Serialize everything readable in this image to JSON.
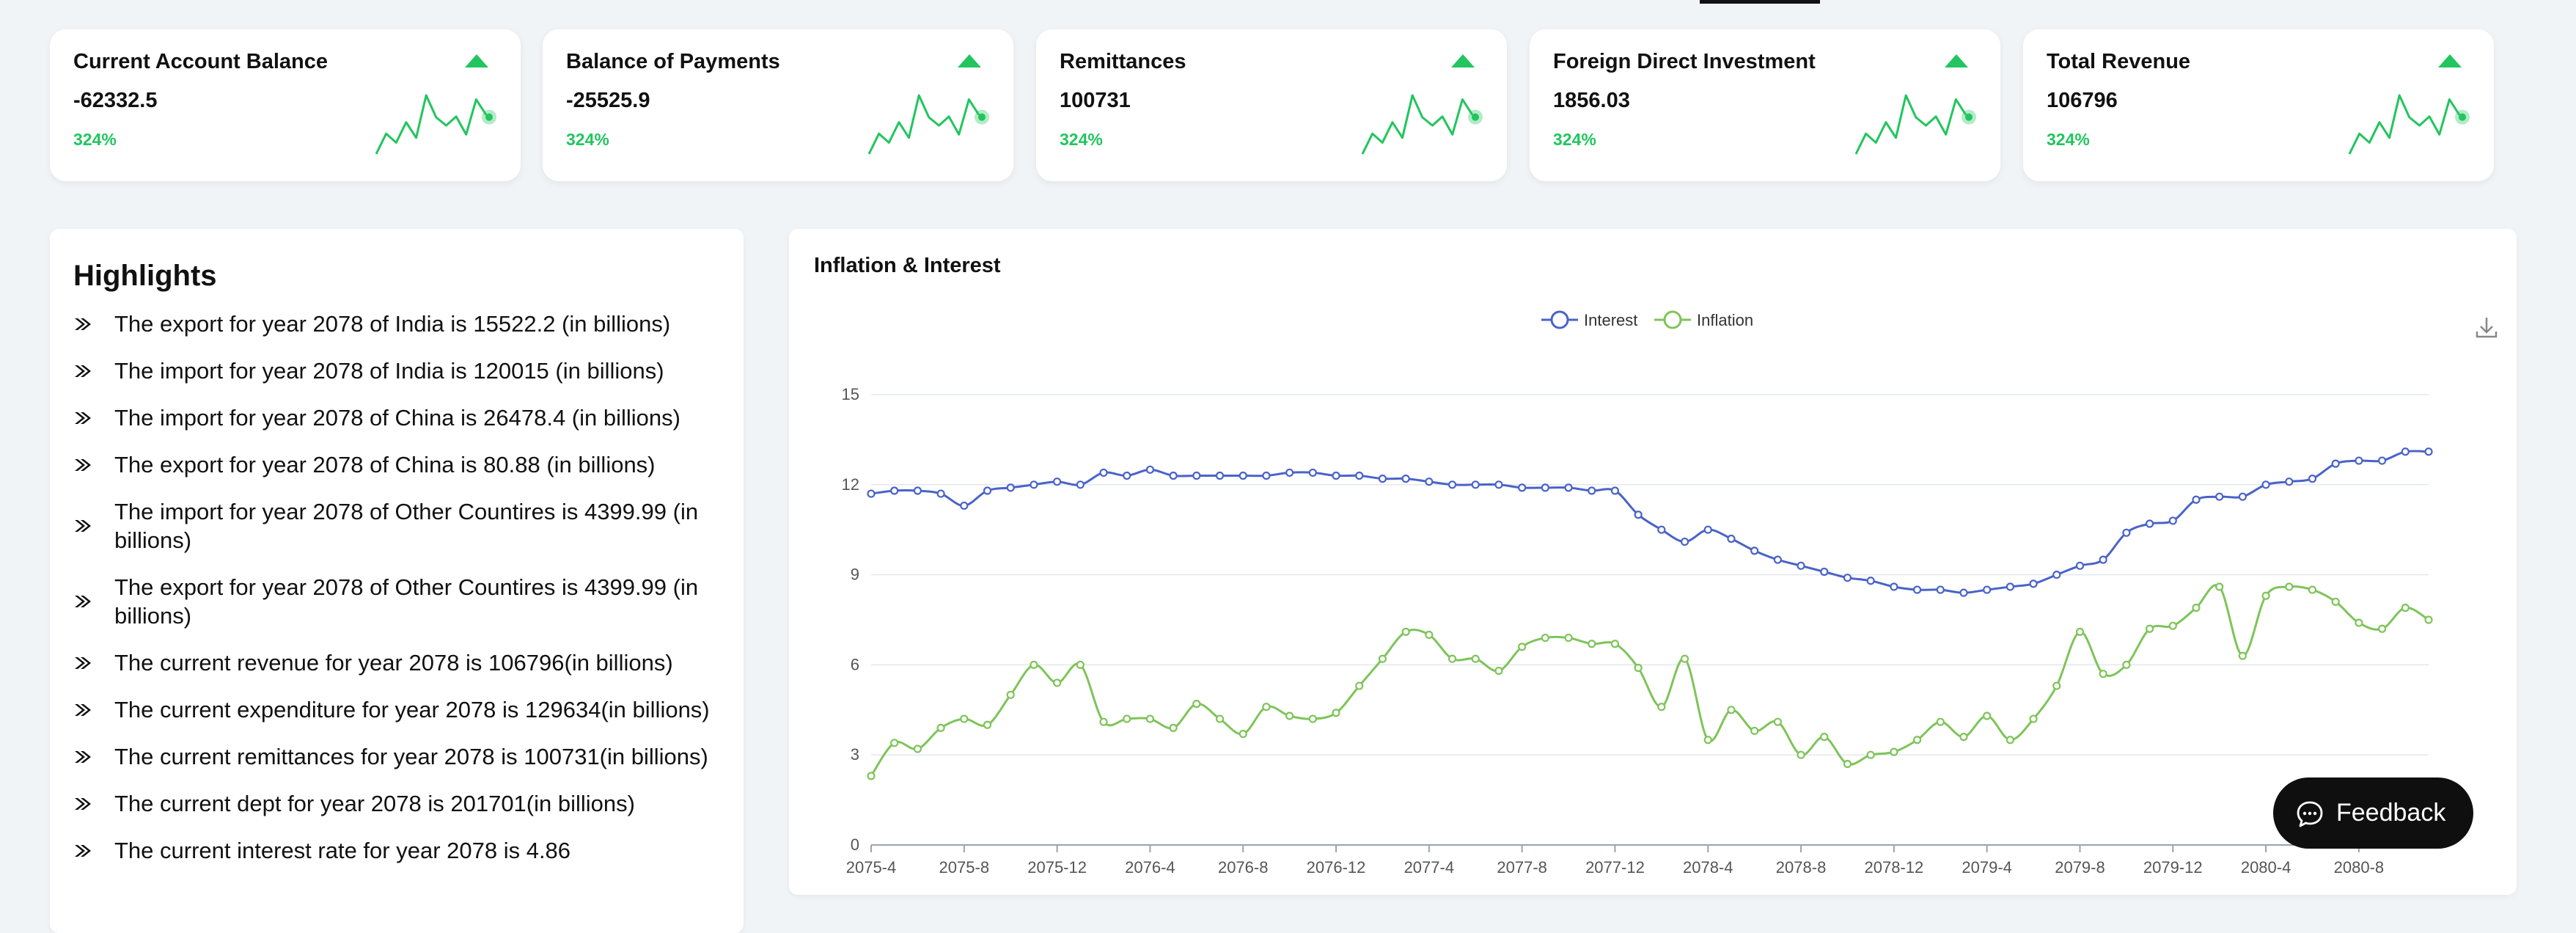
{
  "kpis": [
    {
      "title": "Current Account Balance",
      "value": "-62332.5",
      "change": "324%"
    },
    {
      "title": "Balance of Payments",
      "value": "-25525.9",
      "change": "324%"
    },
    {
      "title": "Remittances",
      "value": "100731",
      "change": "324%"
    },
    {
      "title": "Foreign Direct Investment",
      "value": "1856.03",
      "change": "324%"
    },
    {
      "title": "Total Revenue",
      "value": "106796",
      "change": "324%"
    }
  ],
  "highlights": {
    "title": "Highlights",
    "items": [
      "The export for year 2078 of India is 15522.2 (in billions)",
      "The import for year 2078 of India is 120015 (in billions)",
      "The import for year 2078 of China is 26478.4 (in billions)",
      "The export for year 2078 of China is 80.88 (in billions)",
      "The import for year 2078 of Other Countires is 4399.99 (in billions)",
      "The export for year 2078 of Other Countires is 4399.99 (in billions)",
      "The current revenue for year 2078 is 106796(in billions)",
      "The current expenditure for year 2078 is 129634(in billions)",
      "The current remittances for year 2078 is 100731(in billions)",
      "The current dept for year 2078 is 201701(in billions)",
      "The current interest rate for year 2078 is 4.86"
    ]
  },
  "feedback": {
    "label": "Feedback"
  },
  "colors": {
    "interest": "#4a63c8",
    "inflation": "#7ec459",
    "accent": "#22c55e"
  },
  "chart_data": {
    "type": "line",
    "title": "Inflation & Interest",
    "xlabel": "",
    "ylabel": "",
    "ylim": [
      0,
      15
    ],
    "yticks": [
      0,
      3,
      6,
      9,
      12,
      15
    ],
    "grid": true,
    "legend": "top-center",
    "x_tick_labels": [
      "2075-4",
      "2075-8",
      "2075-12",
      "2076-4",
      "2076-8",
      "2076-12",
      "2077-4",
      "2077-8",
      "2077-12",
      "2078-4",
      "2078-8",
      "2078-12",
      "2079-4",
      "2079-8",
      "2079-12",
      "2080-4",
      "2080-8"
    ],
    "x_tick_every": 4,
    "series": [
      {
        "name": "Interest",
        "values": [
          11.7,
          11.8,
          11.8,
          11.7,
          11.3,
          11.8,
          11.9,
          12.0,
          12.1,
          12.0,
          12.4,
          12.3,
          12.5,
          12.3,
          12.3,
          12.3,
          12.3,
          12.3,
          12.4,
          12.4,
          12.3,
          12.3,
          12.2,
          12.2,
          12.1,
          12.0,
          12.0,
          12.0,
          11.9,
          11.9,
          11.9,
          11.8,
          11.8,
          11.0,
          10.5,
          10.1,
          10.5,
          10.2,
          9.8,
          9.5,
          9.3,
          9.1,
          8.9,
          8.8,
          8.6,
          8.5,
          8.5,
          8.4,
          8.5,
          8.6,
          8.7,
          9.0,
          9.3,
          9.5,
          10.4,
          10.7,
          10.8,
          11.5,
          11.6,
          11.6,
          12.0,
          12.1,
          12.2,
          12.7,
          12.8,
          12.8,
          13.1,
          13.1
        ]
      },
      {
        "name": "Inflation",
        "values": [
          2.3,
          3.4,
          3.2,
          3.9,
          4.2,
          4.0,
          5.0,
          6.0,
          5.4,
          6.0,
          4.1,
          4.2,
          4.2,
          3.9,
          4.7,
          4.2,
          3.7,
          4.6,
          4.3,
          4.2,
          4.4,
          5.3,
          6.2,
          7.1,
          7.0,
          6.2,
          6.2,
          5.8,
          6.6,
          6.9,
          6.9,
          6.7,
          6.7,
          5.9,
          4.6,
          6.2,
          3.5,
          4.5,
          3.8,
          4.1,
          3.0,
          3.6,
          2.7,
          3.0,
          3.1,
          3.5,
          4.1,
          3.6,
          4.3,
          3.5,
          4.2,
          5.3,
          7.1,
          5.7,
          6.0,
          7.2,
          7.3,
          7.9,
          8.6,
          6.3,
          8.3,
          8.6,
          8.5,
          8.1,
          7.4,
          7.2,
          7.9,
          7.5
        ]
      }
    ]
  }
}
